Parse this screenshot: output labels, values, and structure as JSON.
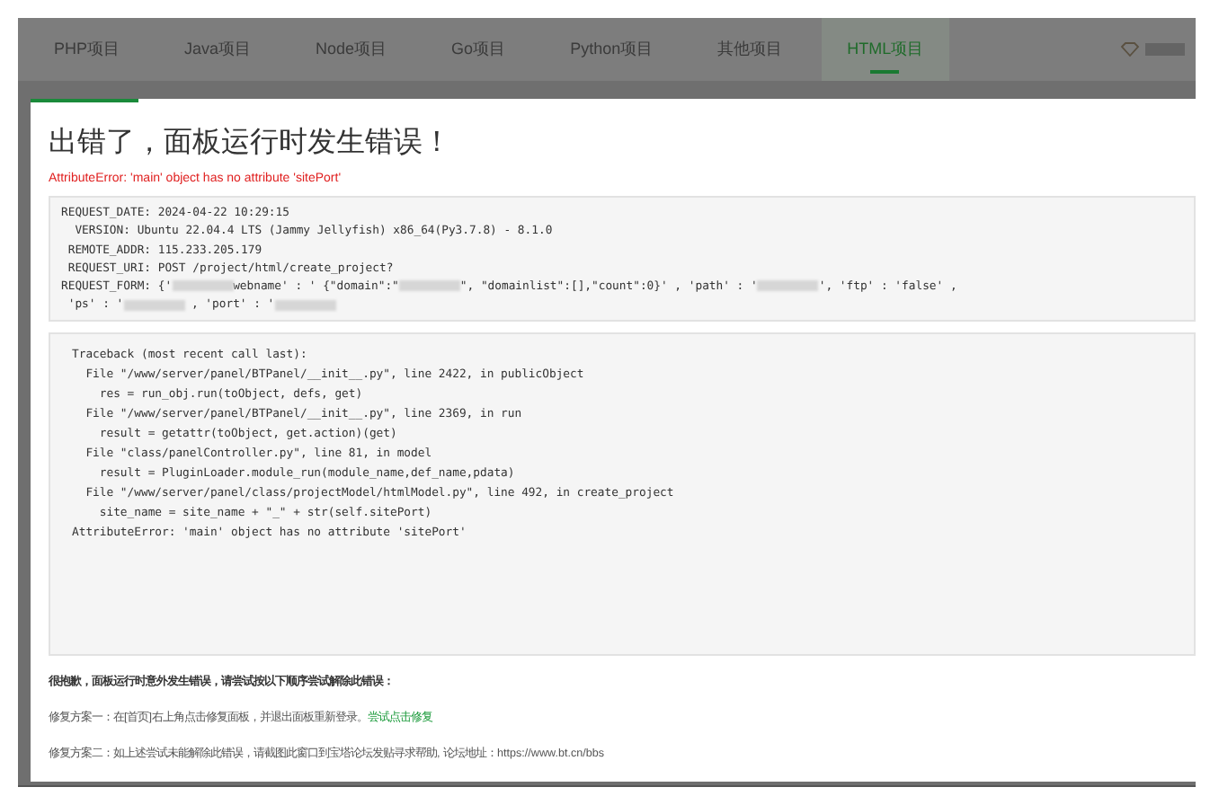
{
  "tabs": [
    {
      "label": "PHP项目",
      "selected": false
    },
    {
      "label": "Java项目",
      "selected": false
    },
    {
      "label": "Node项目",
      "selected": false
    },
    {
      "label": "Go项目",
      "selected": false
    },
    {
      "label": "Python项目",
      "selected": false
    },
    {
      "label": "其他项目",
      "selected": false
    },
    {
      "label": "HTML项目",
      "selected": true
    }
  ],
  "dialog": {
    "title": "出错了，面板运行时发生错误！",
    "error": "AttributeError: 'main' object has no attribute 'sitePort'",
    "request_lines": [
      [
        {
          "kind": "text",
          "text": "REQUEST_DATE: 2024-04-22 10:29:15"
        }
      ],
      [
        {
          "kind": "text",
          "text": "  VERSION: Ubuntu 22.04.4 LTS (Jammy Jellyfish) x86_64(Py3.7.8) - 8.1.0"
        }
      ],
      [
        {
          "kind": "text",
          "text": " REMOTE_ADDR: 115.233.205.179"
        }
      ],
      [
        {
          "kind": "text",
          "text": " REQUEST_URI: POST /project/html/create_project?"
        }
      ],
      [
        {
          "kind": "text",
          "text": "REQUEST_FORM: {'"
        },
        {
          "kind": "redacted"
        },
        {
          "kind": "text",
          "text": "webname' : ' {\"domain\":\""
        },
        {
          "kind": "redacted"
        },
        {
          "kind": "text",
          "text": "\", \"domainlist\":[],\"count\":0}' , 'path' : '"
        },
        {
          "kind": "redacted"
        },
        {
          "kind": "text",
          "text": "', 'ftp' : 'false' ,"
        }
      ],
      [
        {
          "kind": "text",
          "text": " 'ps' : '"
        },
        {
          "kind": "redacted"
        },
        {
          "kind": "text",
          "text": " , 'port' : '"
        },
        {
          "kind": "redacted"
        }
      ]
    ],
    "traceback_lines": [
      "Traceback (most recent call last):",
      "  File \"/www/server/panel/BTPanel/__init__.py\", line 2422, in publicObject",
      "    res = run_obj.run(toObject, defs, get)",
      "  File \"/www/server/panel/BTPanel/__init__.py\", line 2369, in run",
      "    result = getattr(toObject, get.action)(get)",
      "  File \"class/panelController.py\", line 81, in model",
      "    result = PluginLoader.module_run(module_name,def_name,pdata)",
      "  File \"/www/server/panel/class/projectModel/htmlModel.py\", line 492, in create_project",
      "    site_name = site_name + \"_\" + str(self.sitePort)",
      "AttributeError: 'main' object has no attribute 'sitePort'"
    ],
    "help_title": "很抱歉，面板运行时意外发生错误，请尝试按以下顺序尝试解除此错误：",
    "fix_1": "修复方案一：在[首页]右上角点击修复面板，并退出面板重新登录。",
    "fix_1_link": "尝试点击修复",
    "fix_2": "修复方案二：如上述尝试未能解除此错误，请截图此窗口到宝塔论坛发贴寻求帮助, 论坛地址：https://www.bt.cn/bbs"
  }
}
